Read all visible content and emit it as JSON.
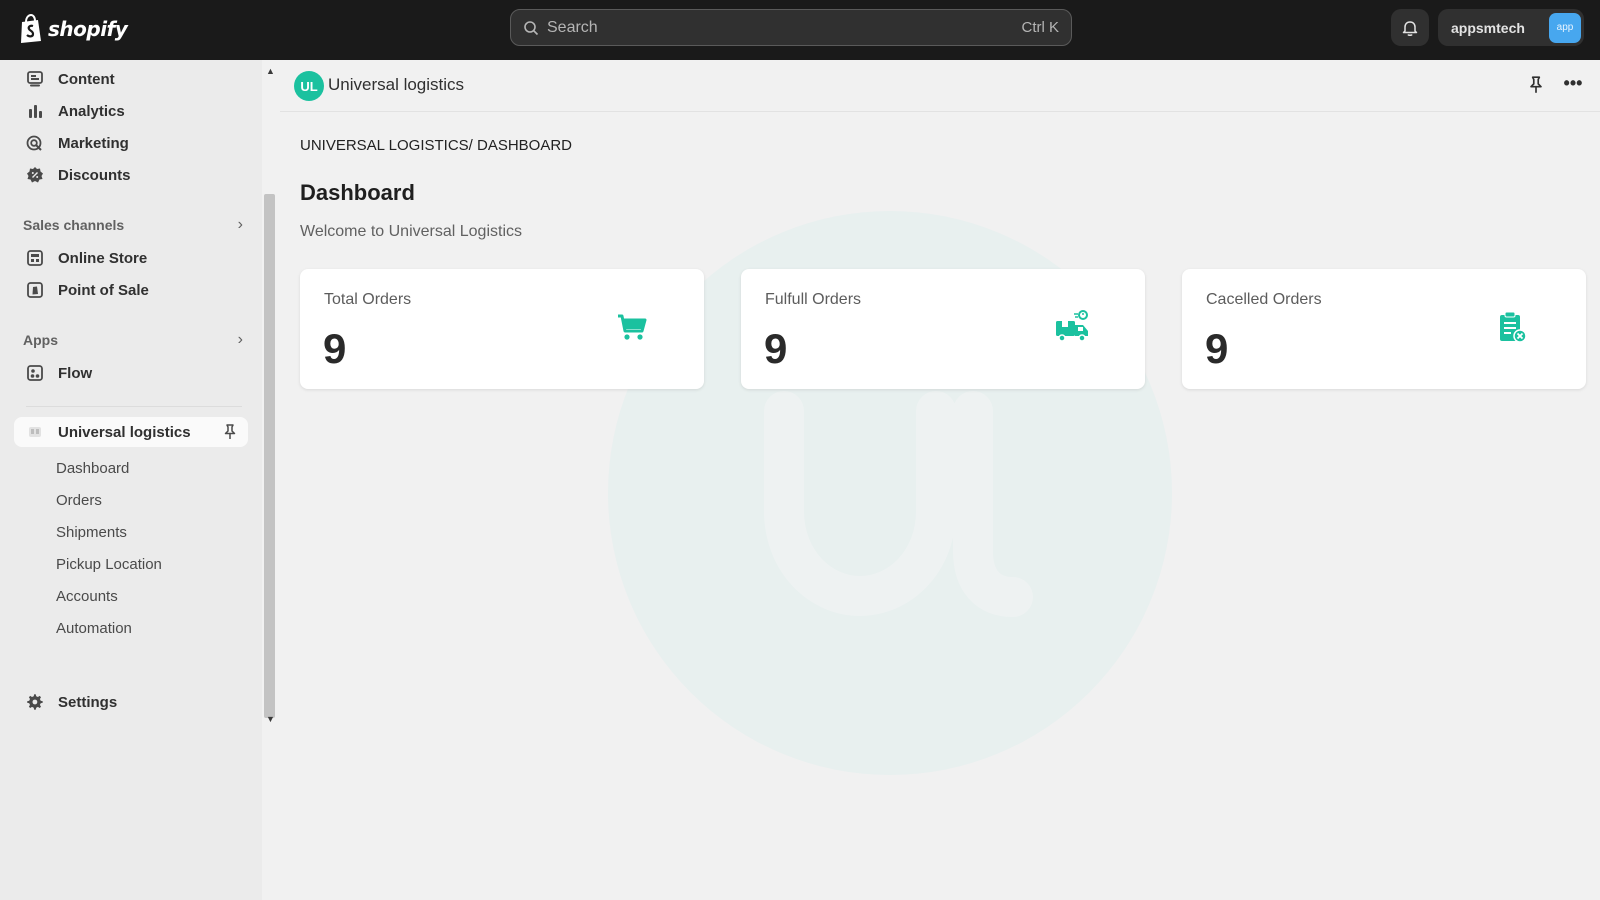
{
  "colors": {
    "accent": "#1bc19f",
    "topbar": "#1a1a1a",
    "avatar": "#47a7ef"
  },
  "topbar": {
    "brand": "shopify",
    "search_placeholder": "Search",
    "search_shortcut": "Ctrl K",
    "store_name": "appsmtech",
    "store_avatar": "app"
  },
  "sidebar": {
    "items": [
      {
        "label": "Content",
        "icon": "content-icon"
      },
      {
        "label": "Analytics",
        "icon": "analytics-icon"
      },
      {
        "label": "Marketing",
        "icon": "marketing-icon"
      },
      {
        "label": "Discounts",
        "icon": "discounts-icon"
      }
    ],
    "sales_channels": {
      "heading": "Sales channels",
      "items": [
        {
          "label": "Online Store",
          "icon": "online-store-icon"
        },
        {
          "label": "Point of Sale",
          "icon": "point-of-sale-icon"
        }
      ]
    },
    "apps": {
      "heading": "Apps",
      "items": [
        {
          "label": "Flow",
          "icon": "flow-icon"
        }
      ]
    },
    "active_app": {
      "label": "Universal logistics",
      "sub_items": [
        "Dashboard",
        "Orders",
        "Shipments",
        "Pickup Location",
        "Accounts",
        "Automation"
      ]
    },
    "settings_label": "Settings"
  },
  "app_header": {
    "logo_text": "UL",
    "title": "Universal logistics"
  },
  "main": {
    "breadcrumb": "UNIVERSAL LOGISTICS/ DASHBOARD",
    "title": "Dashboard",
    "welcome": "Welcome to Universal Logistics",
    "cards": [
      {
        "title": "Total Orders",
        "value": "9",
        "icon": "cart-icon"
      },
      {
        "title": "Fulfull Orders",
        "value": "9",
        "icon": "delivery-truck-icon"
      },
      {
        "title": "Cacelled Orders",
        "value": "9",
        "icon": "cancelled-clipboard-icon"
      }
    ]
  }
}
